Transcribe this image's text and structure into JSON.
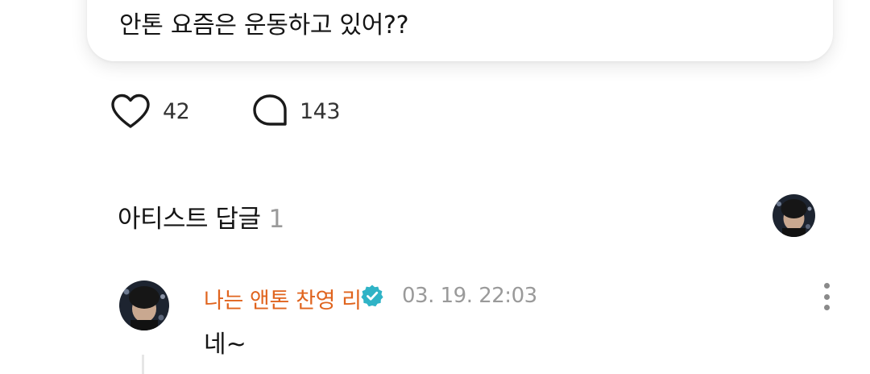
{
  "post": {
    "text": "안톤 요즘은 운동하고 있어??"
  },
  "reactions": {
    "like_count": "42",
    "comment_count": "143"
  },
  "artist_reply": {
    "title": "아티스트 답글",
    "count": "1"
  },
  "reply": {
    "author": "나는 앤톤 찬영 리",
    "timestamp": "03. 19. 22:03",
    "text": "네~"
  },
  "icons": {
    "like": "heart-outline-icon",
    "comment": "speech-bubble-icon",
    "verified": "verified-badge-icon",
    "more": "more-vertical-icon"
  },
  "colors": {
    "author_name": "#e0641e",
    "verified_badge": "#2fb3c6",
    "muted_text": "#9a9a9a"
  }
}
